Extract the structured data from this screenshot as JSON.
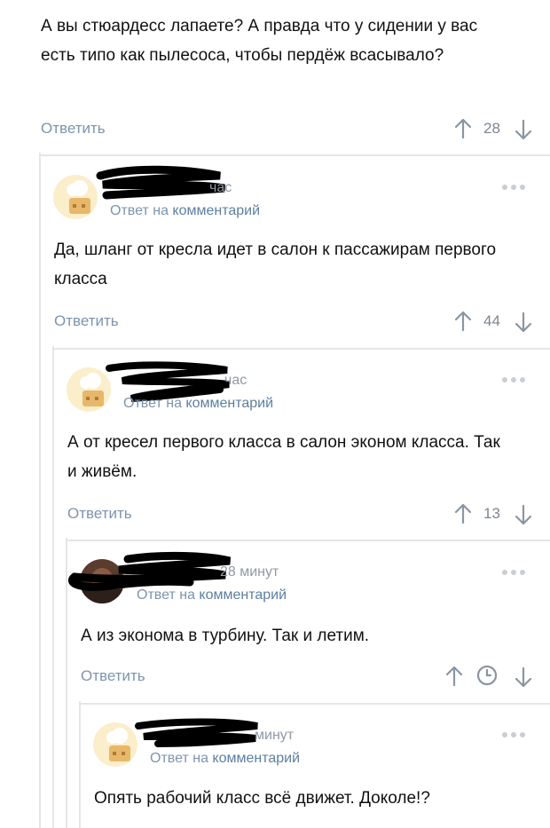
{
  "comments": [
    {
      "text": "А вы стюардесс лапаете? А правда что у сидении у вас есть типо как пылесоса, чтобы пердёж всасывало?",
      "reply_label": "Ответить",
      "rating": "28"
    },
    {
      "time": "час",
      "reply_to": "Ответ на",
      "reply_to_link": "комментарий",
      "text": "Да, шланг от кресла идет в салон к пассажирам первого класса",
      "reply_label": "Ответить",
      "rating": "44"
    },
    {
      "time": "час",
      "reply_to": "Ответ на",
      "reply_to_link": "комментарий",
      "text": "А от кресел первого класса в салон эконом класса. Так и живём.",
      "reply_label": "Ответить",
      "rating": "13"
    },
    {
      "time": "28 минут",
      "reply_to": "Ответ на",
      "reply_to_link": "комментарий",
      "text": "А из эконома в турбину. Так и летим.",
      "reply_label": "Ответить",
      "rating_icon": "clock-icon"
    },
    {
      "time": "минут",
      "reply_to": "Ответ на",
      "reply_to_link": "комментарий",
      "text": "Опять рабочий класс всё движет. Доколе!?"
    }
  ],
  "icons": {
    "up": "arrow-up-icon",
    "down": "arrow-down-icon",
    "more": "more-dots-icon"
  },
  "colors": {
    "accent": "#7d94ad",
    "thread_line": "#e3e6e9",
    "muted": "#7a8793"
  }
}
